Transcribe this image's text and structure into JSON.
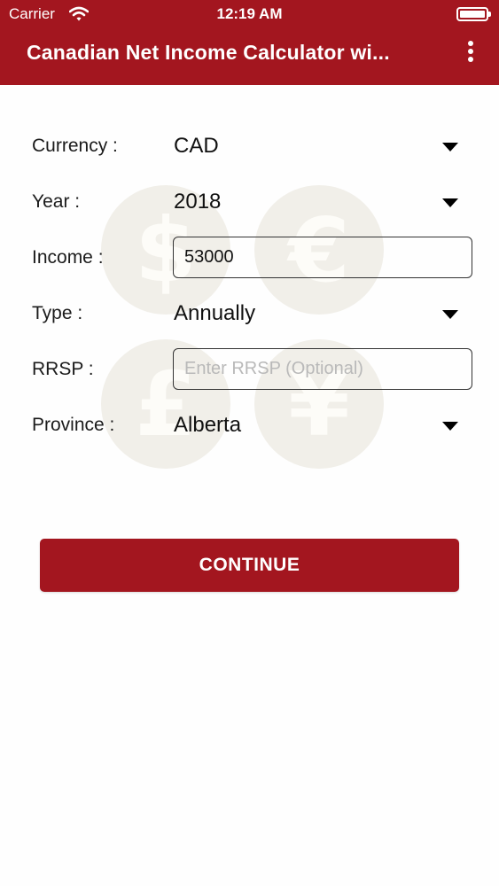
{
  "status_bar": {
    "carrier": "Carrier",
    "time": "12:19 AM"
  },
  "app_bar": {
    "title": "Canadian Net Income Calculator wi...",
    "menu_icon": "more-vertical-icon"
  },
  "watermark": {
    "symbols": [
      "$",
      "€",
      "£",
      "¥"
    ]
  },
  "form": {
    "currency": {
      "label": "Currency :",
      "value": "CAD"
    },
    "year": {
      "label": "Year :",
      "value": "2018"
    },
    "income": {
      "label": "Income :",
      "value": "53000"
    },
    "type": {
      "label": "Type :",
      "value": "Annually"
    },
    "rrsp": {
      "label": "RRSP :",
      "value": "",
      "placeholder": "Enter RRSP (Optional)"
    },
    "province": {
      "label": "Province :",
      "value": "Alberta"
    }
  },
  "continue_button": {
    "label": "CONTINUE"
  },
  "colors": {
    "brand": "#a3161f",
    "background": "#fefefe"
  }
}
